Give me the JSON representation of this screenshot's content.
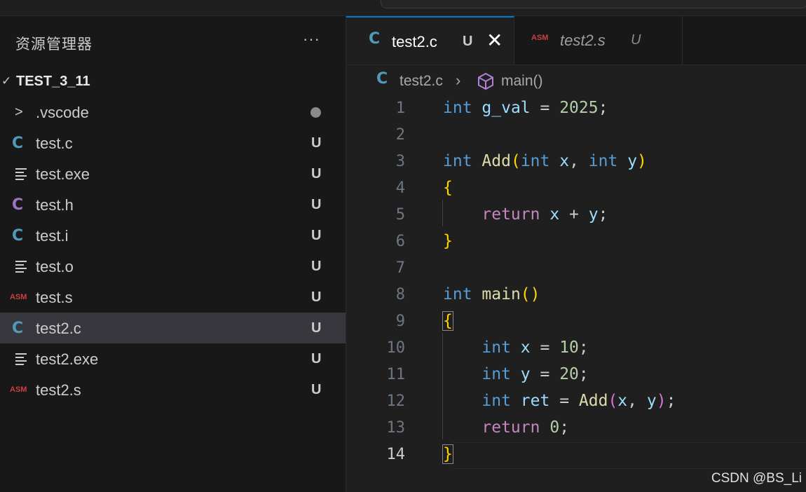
{
  "sidebar": {
    "title": "资源管理器",
    "more_label": "···",
    "folder": {
      "chevron": "✓",
      "name": "TEST_3_11"
    },
    "files": [
      {
        "name": ".vscode",
        "icon": "chevron-right-icon",
        "status": ""
      },
      {
        "name": "test.c",
        "icon": "c-file-icon",
        "status": "U"
      },
      {
        "name": "test.exe",
        "icon": "text-lines-icon",
        "status": "U"
      },
      {
        "name": "test.h",
        "icon": "c-header-icon",
        "status": "U"
      },
      {
        "name": "test.i",
        "icon": "c-file-icon",
        "status": "U"
      },
      {
        "name": "test.o",
        "icon": "text-lines-icon",
        "status": "U"
      },
      {
        "name": "test.s",
        "icon": "asm-icon",
        "status": "U"
      },
      {
        "name": "test2.c",
        "icon": "c-file-icon",
        "status": "U",
        "selected": true
      },
      {
        "name": "test2.exe",
        "icon": "text-lines-icon",
        "status": "U"
      },
      {
        "name": "test2.s",
        "icon": "asm-icon",
        "status": "U"
      }
    ]
  },
  "tabs": [
    {
      "icon_text": "C",
      "label": "test2.c",
      "status": "U",
      "close": "✕",
      "active": true
    },
    {
      "icon_text": "ASM",
      "label": "test2.s",
      "status": "U",
      "active": false
    }
  ],
  "breadcrumb": {
    "icon_text": "C",
    "file": "test2.c",
    "separator": "›",
    "symbol": "main()"
  },
  "editor": {
    "line_numbers": [
      "1",
      "2",
      "3",
      "4",
      "5",
      "6",
      "7",
      "8",
      "9",
      "10",
      "11",
      "12",
      "13",
      "14"
    ],
    "active_line": "14"
  },
  "icons": {
    "c_text": "C",
    "asm_text": "ASM"
  },
  "colors": {
    "background": "#1f1f1f",
    "keyword": "#569cd6",
    "control": "#c586c0",
    "function": "#dcdcaa",
    "variable": "#9cdcfe",
    "number": "#b5cea8",
    "bracket": "#ffd700",
    "accent": "#0078d4"
  },
  "watermark": "CSDN @BS_Li"
}
